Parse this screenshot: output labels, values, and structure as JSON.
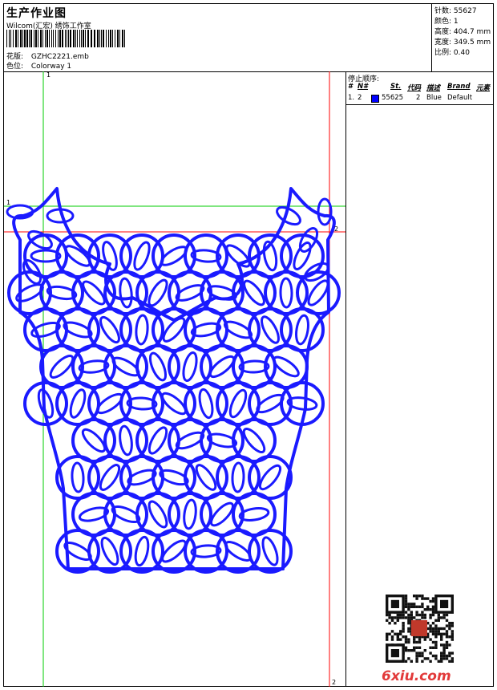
{
  "header": {
    "title": "生产作业图",
    "company": "Wilcom(汇宏) 绣饰工作室",
    "design_label": "花版:",
    "design_value": "GZHC2221.emb",
    "colorway_label": "色位:",
    "colorway_value": "Colorway 1"
  },
  "stats": {
    "stitches_label": "针数:",
    "stitches_value": "55627",
    "colors_label": "颜色:",
    "colors_value": "1",
    "height_label": "高度:",
    "height_value": "404.7 mm",
    "width_label": "宽度:",
    "width_value": "349.5 mm",
    "scale_label": "比例:",
    "scale_value": "0.40"
  },
  "stop_sequence": {
    "title": "停止顺序:",
    "headers": {
      "num": "#",
      "n": "N#",
      "st": "St.",
      "code": "代码",
      "desc": "描述",
      "brand": "Brand",
      "element": "元素"
    },
    "rows": [
      {
        "num": "1.",
        "n": "2",
        "st": "55625",
        "code": "2",
        "desc": "Blue",
        "brand": "Default",
        "color": "#0000ff"
      }
    ]
  },
  "guides": {
    "top_label": "1",
    "left_label": "1",
    "right_label": "2",
    "bottom_label": "2"
  },
  "design": {
    "thread_color": "#1a1aff"
  },
  "watermark": "6xiu.com"
}
